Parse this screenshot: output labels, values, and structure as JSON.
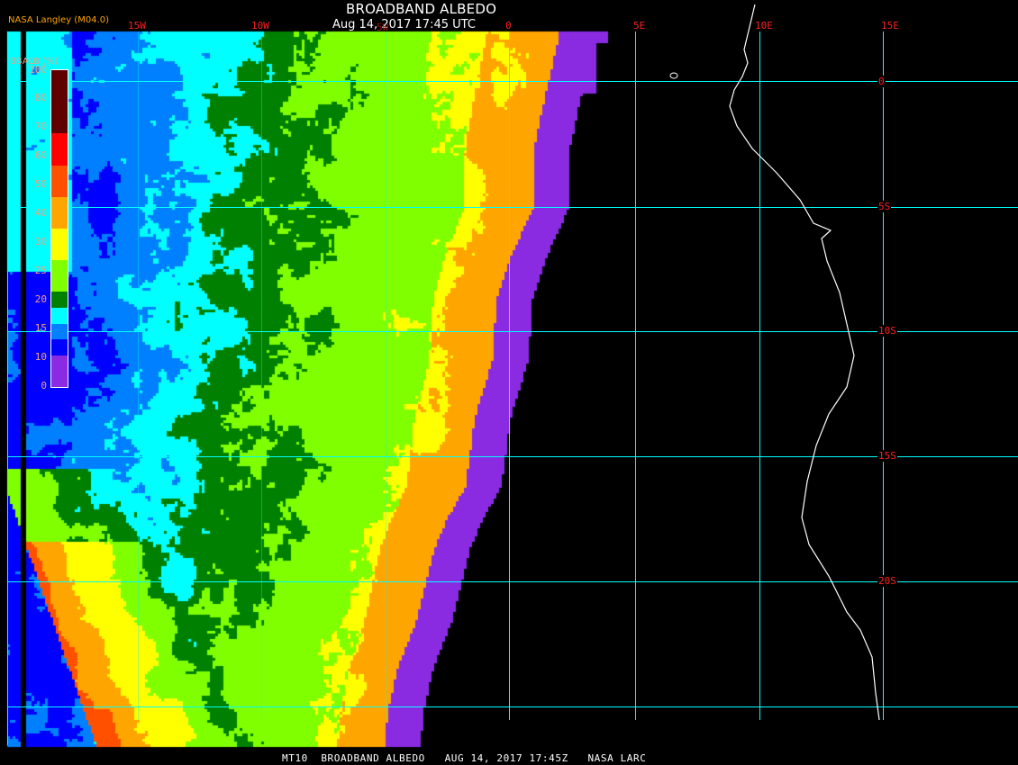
{
  "header": {
    "title": "BROADBAND ALBEDO",
    "timestamp": "Aug 14, 2017 17:45 UTC",
    "credit": "NASA Langley (M04.0)"
  },
  "legend": {
    "title": "BBALB (%)",
    "ticks": [
      "0",
      "10",
      "15",
      "20",
      "25",
      "30",
      "40",
      "50",
      "60",
      "70",
      "80",
      "100"
    ],
    "colors": [
      "#8a2be2",
      "#0000ff",
      "#0080ff",
      "#00ffff",
      "#008000",
      "#80ff00",
      "#ffff00",
      "#ffa500",
      "#ff5000",
      "#ff0000",
      "#600000"
    ]
  },
  "axes": {
    "longitude_labels": [
      "15W",
      "10W",
      "5W",
      "0",
      "5E",
      "10E",
      "15E"
    ],
    "latitude_labels": [
      "0",
      "5S",
      "10S",
      "15S",
      "20S"
    ],
    "grid_color": "#00ffff",
    "label_color": "#ff2020",
    "coastline_color": "#ffffff"
  },
  "footer": {
    "text": "MT10  BROADBAND ALBEDO   AUG 14, 2017 17:45Z   NASA LARC"
  }
}
